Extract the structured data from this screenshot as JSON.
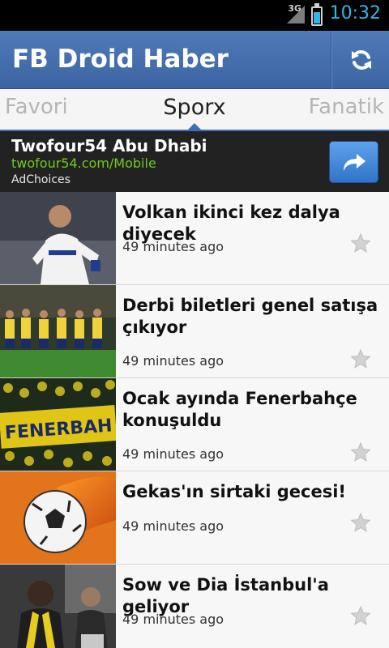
{
  "status_bar": {
    "network": "3G",
    "time": "10:32",
    "battery_icon": "battery-icon",
    "signal_icon": "signal-icon"
  },
  "app": {
    "title": "FB Droid Haber",
    "refresh_icon": "refresh-icon"
  },
  "tabs": [
    {
      "label": "Favori",
      "selected": false
    },
    {
      "label": "Sporx",
      "selected": true
    },
    {
      "label": "Fanatik",
      "selected": false
    }
  ],
  "ad": {
    "title": "Twofour54 Abu Dhabi",
    "url": "twofour54.com/Mobile",
    "choices": "AdChoices",
    "action_icon": "share-arrow-icon"
  },
  "news": [
    {
      "headline": "Volkan ikinci kez dalya diyecek",
      "time": "49 minutes ago",
      "image": "goalkeeper-photo"
    },
    {
      "headline": "Derbi biletleri genel satışa çıkıyor",
      "time": "49 minutes ago",
      "image": "team-lineup-photo"
    },
    {
      "headline": "Ocak ayında Fenerbahçe konuşuldu",
      "time": "49 minutes ago",
      "image": "fenerbahce-fans-photo"
    },
    {
      "headline": "Gekas'ın sirtaki gecesi!",
      "time": "49 minutes ago",
      "image": "fireball-soccer-photo"
    },
    {
      "headline": "Sow ve Dia İstanbul'a geliyor",
      "time": "49 minutes ago",
      "image": "airport-fans-photo"
    }
  ],
  "colors": {
    "action_bar": "#4470ad",
    "tab_indicator": "#3a6fb8",
    "clock": "#33b5e5",
    "ad_url": "#6ccf1a"
  }
}
